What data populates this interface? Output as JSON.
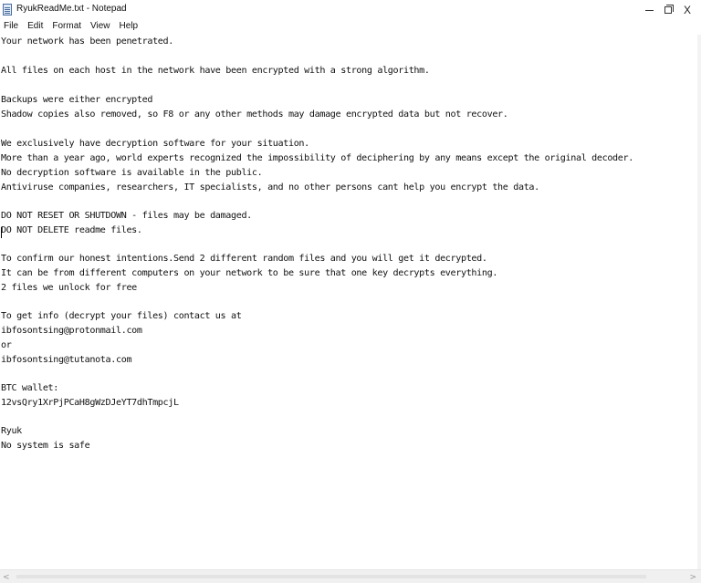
{
  "window": {
    "title": "RyukReadMe.txt - Notepad",
    "icon": "notepad-icon",
    "controls": {
      "minimize": "minimize",
      "maximize": "maximize",
      "close": "X"
    }
  },
  "menu": [
    "File",
    "Edit",
    "Format",
    "View",
    "Help"
  ],
  "document": {
    "lines": [
      "Your network has been penetrated.",
      "",
      "All files on each host in the network have been encrypted with a strong algorithm.",
      "",
      "Backups were either encrypted",
      "Shadow copies also removed, so F8 or any other methods may damage encrypted data but not recover.",
      "",
      "We exclusively have decryption software for your situation.",
      "More than a year ago, world experts recognized the impossibility of deciphering by any means except the original decoder.",
      "No decryption software is available in the public.",
      "Antiviruse companies, researchers, IT specialists, and no other persons cant help you encrypt the data.",
      "",
      "DO NOT RESET OR SHUTDOWN - files may be damaged.",
      "DO NOT DELETE readme files.",
      "",
      "To confirm our honest intentions.Send 2 different random files and you will get it decrypted.",
      "It can be from different computers on your network to be sure that one key decrypts everything.",
      "2 files we unlock for free",
      "",
      "To get info (decrypt your files) contact us at",
      "ibfosontsing@protonmail.com",
      "or",
      "ibfosontsing@tutanota.com",
      "",
      "BTC wallet:",
      "12vsQry1XrPjPCaH8gWzDJeYT7dhTmpcjL",
      "",
      "Ryuk",
      "No system is safe"
    ]
  },
  "scrollbar": {
    "left_arrow": "<",
    "right_arrow": ">"
  }
}
